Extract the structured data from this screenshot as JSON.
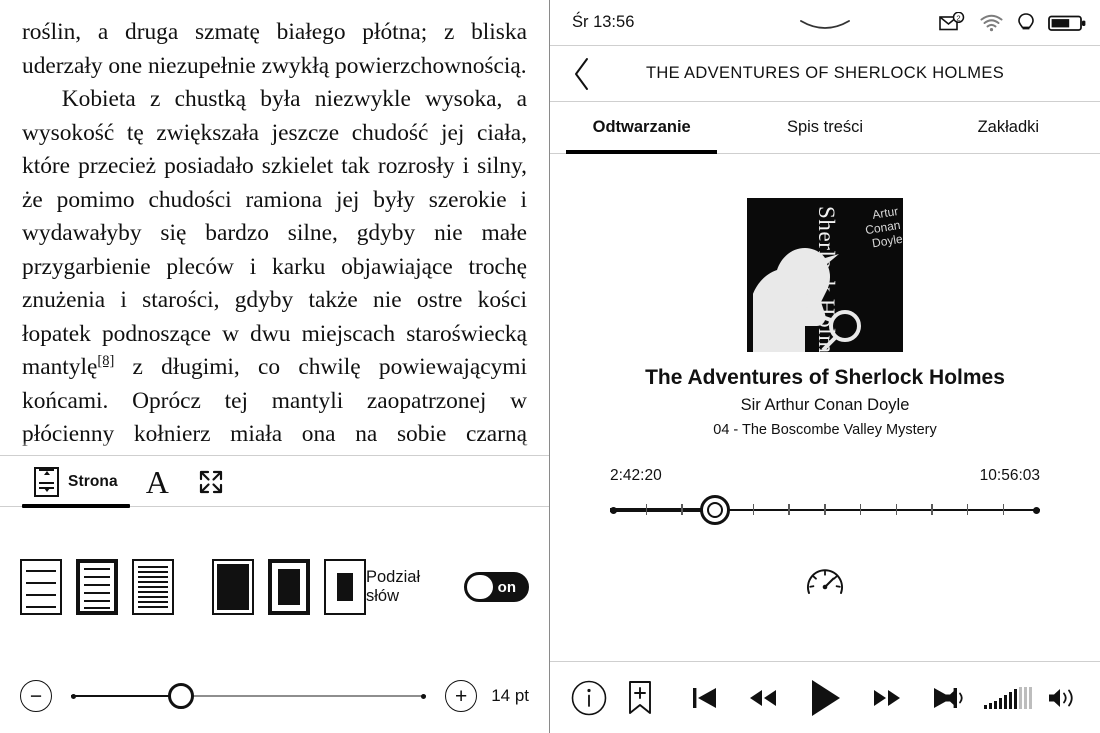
{
  "reader": {
    "paragraphs": [
      "roślin, a druga szmatę białego płótna; z bliska uderzały one niezupełnie zwykłą powierzchownością.",
      "Kobieta z chustką była niezwykle wysoka, a wysokość tę zwiększała jeszcze chudość jej ciała, które przecież posiadało szkielet tak rozrosły i silny, że pomimo chudości ramiona jej były szerokie i wydawałyby się bardzo silne, gdyby nie małe przygarbienie pleców i karku objawiające trochę znużenia i starości, gdyby także nie ostre kości łopatek podnoszące w dwu miejscach staroświecką mantylę"
    ],
    "footnote_marker": "[8]",
    "paragraph_tail": " z długimi, co chwilę powiewającymi końcami. Oprócz tej mantyli zaopatrzonej w płócienny kołnierz miała ona na sobie czarną spódnicę, tak krótką, że spod niej aż prawie do",
    "toolbar": {
      "page_tab_label": "Strona",
      "page_icon": "page-margins-icon",
      "font_icon": "font-size-A-icon",
      "fullscreen_icon": "fullscreen-expand-icon"
    },
    "settings": {
      "line_spacing_presets": [
        {
          "name": "line-spacing-wide",
          "lines": 4,
          "selected": false
        },
        {
          "name": "line-spacing-medium",
          "lines": 6,
          "selected": true
        },
        {
          "name": "line-spacing-narrow",
          "lines": 9,
          "selected": false
        }
      ],
      "margin_presets": [
        {
          "name": "margin-small",
          "selected": false
        },
        {
          "name": "margin-medium",
          "selected": true
        },
        {
          "name": "margin-large",
          "selected": false
        }
      ],
      "hyphenation_label": "Podział słów",
      "hyphenation_state": "on",
      "font_size_value": "14 pt",
      "decrease_label": "−",
      "increase_label": "+"
    }
  },
  "player": {
    "status": {
      "time": "Śr 13:56",
      "mail_badge": "2",
      "icons": [
        "mail-icon",
        "wifi-icon",
        "frontlight-bulb-icon",
        "battery-icon"
      ],
      "battery_level": 60
    },
    "header": {
      "back_icon": "chevron-left-icon",
      "title": "THE ADVENTURES OF SHERLOCK HOLMES",
      "minimize_icon": "minimize-icon"
    },
    "tabs": [
      {
        "label": "Odtwarzanie",
        "active": true
      },
      {
        "label": "Spis treści",
        "active": false
      },
      {
        "label": "Zakładki",
        "active": false
      }
    ],
    "cover": {
      "vertical_title": "Sherlock Holmes",
      "author_lines": "Artur Conan Doyle",
      "alt": "sherlock-holmes-book-cover"
    },
    "meta": {
      "title": "The Adventures of Sherlock Holmes",
      "author": "Sir Arthur Conan Doyle",
      "chapter": "04 - The Boscombe Valley Mystery"
    },
    "progress": {
      "elapsed": "2:42:20",
      "total": "10:56:03",
      "percent": 24.5
    },
    "speed_icon": "playback-speed-gauge-icon",
    "controls": {
      "info_icon": "info-icon",
      "bookmark_icon": "add-bookmark-icon",
      "prev_icon": "previous-track-icon",
      "rewind_icon": "rewind-icon",
      "play_icon": "play-icon",
      "forward_icon": "fast-forward-icon",
      "next_icon": "next-track-icon",
      "volume_down_icon": "volume-down-icon",
      "volume_level_icon": "volume-level-bars",
      "volume_up_icon": "volume-up-icon",
      "volume_bars_filled": 7,
      "volume_bars_total": 10
    }
  },
  "colors": {
    "ink": "#111111",
    "rule": "#cfcfcf",
    "divider": "#8a8a8a"
  }
}
